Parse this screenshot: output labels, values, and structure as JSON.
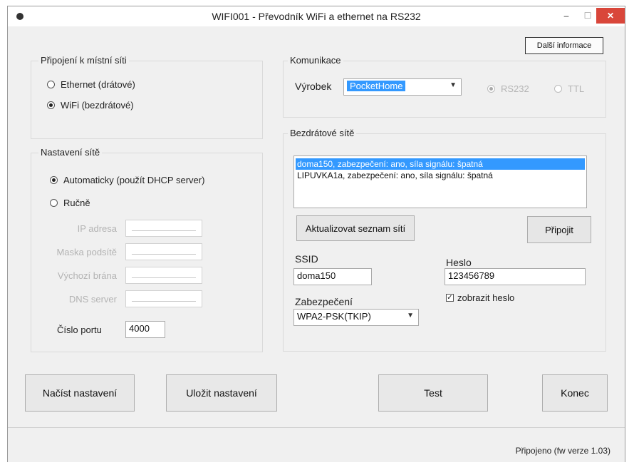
{
  "window": {
    "title": "WIFI001 - Převodník WiFi a ethernet na RS232",
    "min_glyph": "–",
    "max_glyph": "☐",
    "close_glyph": "✕",
    "icon": "app-icon"
  },
  "info_button": "Další informace",
  "connection": {
    "title": "Připojení k místní síti",
    "options": [
      "Ethernet (drátové)",
      "WiFi (bezdrátové)"
    ],
    "selected": 1
  },
  "network": {
    "title": "Nastavení sítě",
    "auto_label": "Automaticky (použít DHCP server)",
    "manual_label": "Ručně",
    "selected": "auto",
    "ip_label": "IP adresa",
    "mask_label": "Maska podsítě",
    "gateway_label": "Výchozí brána",
    "dns_label": "DNS server",
    "port_label": "Číslo portu",
    "port_value": "4000"
  },
  "communication": {
    "title": "Komunikace",
    "product_label": "Výrobek",
    "product_value": "PocketHome",
    "rs232_label": "RS232",
    "ttl_label": "TTL",
    "selected": "RS232"
  },
  "wireless": {
    "title": "Bezdrátové sítě",
    "networks": [
      "doma150, zabezpečení: ano, síla signálu: špatná",
      "LIPUVKA1a, zabezpečení: ano, síla signálu: špatná"
    ],
    "selected_index": 0,
    "refresh_button": "Aktualizovat seznam sítí",
    "connect_button": "Připojit",
    "ssid_label": "SSID",
    "ssid_value": "doma150",
    "password_label": "Heslo",
    "password_value": "123456789",
    "security_label": "Zabezpečení",
    "security_value": "WPA2-PSK(TKIP)",
    "show_password_label": "zobrazit heslo",
    "show_password_checked": true
  },
  "buttons": {
    "load": "Načíst nastavení",
    "save": "Uložit nastavení",
    "test": "Test",
    "close": "Konec"
  },
  "status": {
    "text": "Připojeno (fw verze 1.03)"
  },
  "icons": {
    "dropdown": "chevron-down-icon",
    "check": "checkmark-icon"
  }
}
